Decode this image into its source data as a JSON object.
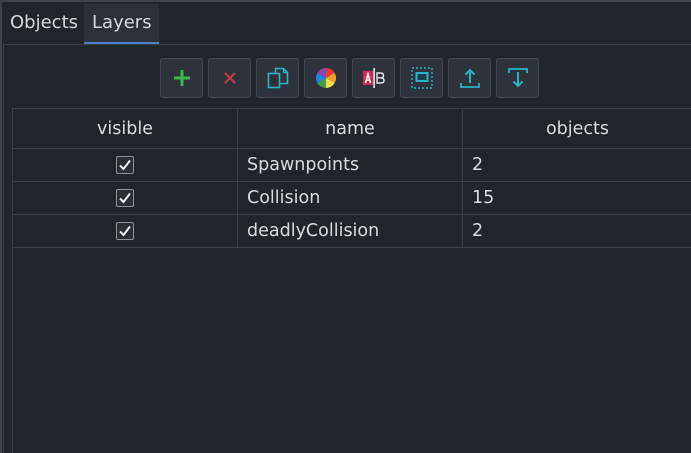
{
  "tabs": [
    {
      "label": "Objects",
      "active": false
    },
    {
      "label": "Layers",
      "active": true
    }
  ],
  "toolbar": [
    {
      "name": "add-layer-button",
      "icon": "plus-icon",
      "color": "#3fb54a"
    },
    {
      "name": "remove-layer-button",
      "icon": "x-icon",
      "color": "#c23a4a"
    },
    {
      "name": "duplicate-layer-button",
      "icon": "copy-icon",
      "color": "#2bb3c9"
    },
    {
      "name": "layer-color-button",
      "icon": "color-wheel-icon",
      "color": "#e0a030"
    },
    {
      "name": "rename-layer-button",
      "icon": "rename-text-icon",
      "color": "#d02a55"
    },
    {
      "name": "select-layer-objects-button",
      "icon": "select-frame-icon",
      "color": "#2bb3c9"
    },
    {
      "name": "move-layer-up-button",
      "icon": "arrow-up-icon",
      "color": "#2bb3c9"
    },
    {
      "name": "move-layer-down-button",
      "icon": "arrow-down-icon",
      "color": "#2bb3c9"
    }
  ],
  "table": {
    "headers": [
      "visible",
      "name",
      "objects"
    ],
    "rows": [
      {
        "visible": true,
        "name": "Spawnpoints",
        "objects": "2"
      },
      {
        "visible": true,
        "name": "Collision",
        "objects": "15"
      },
      {
        "visible": true,
        "name": "deadlyCollision",
        "objects": "2"
      }
    ]
  },
  "colors": {
    "accent": "#4a7fc9",
    "background": "#20242b",
    "grid": "#3a3f48"
  }
}
